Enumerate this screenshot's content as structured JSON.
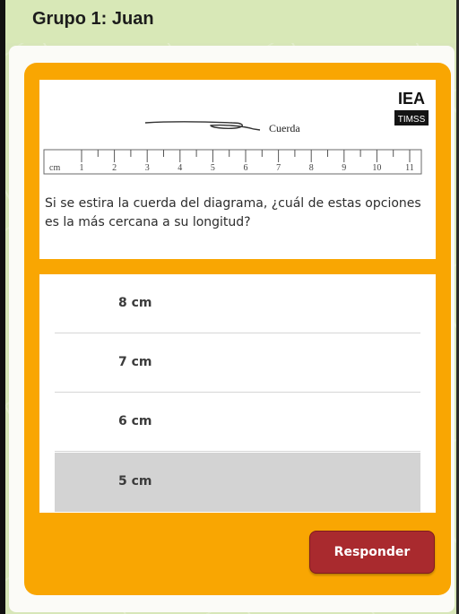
{
  "header": {
    "title": "Grupo 1: Juan"
  },
  "question": {
    "logo": {
      "top_text": "IEA",
      "bottom_text": "TIMSS"
    },
    "diagram": {
      "string_label": "Cuerda",
      "ruler_unit": "cm",
      "ruler_numbers": [
        "1",
        "2",
        "3",
        "4",
        "5",
        "6",
        "7",
        "8",
        "9",
        "10",
        "11"
      ]
    },
    "text": "Si se estira la cuerda del diagrama, ¿cuál de estas opciones es la más cercana a su longitud?"
  },
  "options": [
    {
      "label": "8 cm",
      "selected": false
    },
    {
      "label": "7 cm",
      "selected": false
    },
    {
      "label": "6 cm",
      "selected": false
    },
    {
      "label": "5 cm",
      "selected": true
    }
  ],
  "submit": {
    "label": "Responder"
  },
  "colors": {
    "header_bg": "#d8e8b7",
    "panel": "#f9a602",
    "button": "#a92a2e",
    "selected_option": "#d3d3d3"
  }
}
